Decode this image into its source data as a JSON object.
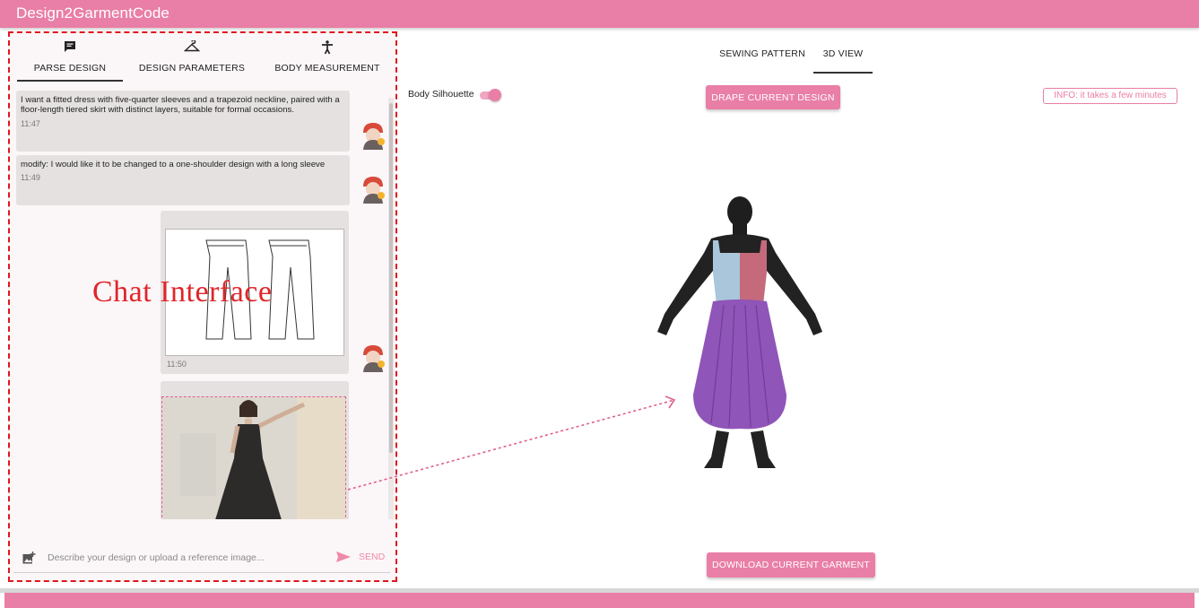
{
  "app": {
    "title": "Design2GarmentCode"
  },
  "left_tabs": [
    {
      "label": "PARSE DESIGN",
      "icon": "chat-icon",
      "active": true
    },
    {
      "label": "DESIGN PARAMETERS",
      "icon": "hanger-icon",
      "active": false
    },
    {
      "label": "BODY MEASUREMENT",
      "icon": "accessibility-icon",
      "active": false
    }
  ],
  "chat": {
    "messages": [
      {
        "text": "I want a fitted dress with five-quarter sleeves and a trapezoid neckline, paired with a floor-length tiered skirt with distinct layers, suitable for formal occasions.",
        "time": "11:47"
      },
      {
        "text": "modify: I would like it to be changed to a one-shoulder design with a long sleeve",
        "time": "11:49"
      },
      {
        "type": "image",
        "content": "pants sketch",
        "time": "11:50"
      },
      {
        "type": "image",
        "content": "dress photo"
      }
    ],
    "annotation_label": "Chat Interface",
    "input": {
      "placeholder": "Describe your design or upload a reference image...",
      "value": ""
    },
    "send_label": "SEND"
  },
  "right_tabs": [
    {
      "label": "SEWING PATTERN",
      "active": false
    },
    {
      "label": "3D VIEW",
      "active": true
    }
  ],
  "view": {
    "silhouette_label": "Body Silhouette",
    "silhouette_on": true,
    "drape_label": "DRAPE CURRENT DESIGN",
    "info_text": "INFO: it takes a few minutes",
    "download_label": "DOWNLOAD CURRENT GARMENT"
  },
  "colors": {
    "accent": "#e97ea6",
    "annotation": "#e0161d",
    "bodice_left": "#a9c6db",
    "bodice_right": "#c46a7b",
    "skirt": "#8f55b8"
  }
}
